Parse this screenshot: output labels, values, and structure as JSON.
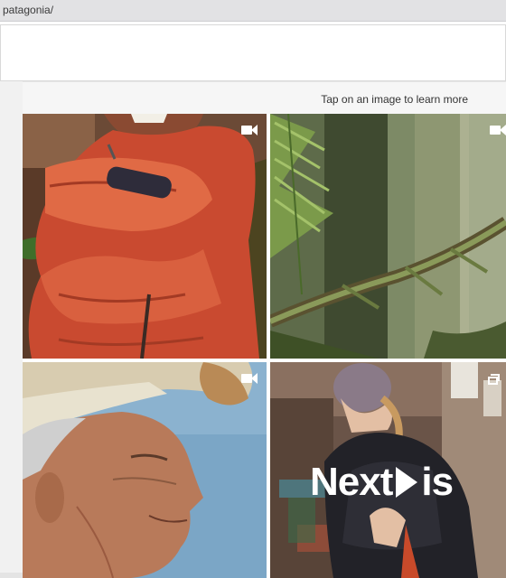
{
  "browser": {
    "address_text": "patagonia/"
  },
  "gallery": {
    "hint": "Tap on an image to learn more",
    "tiles": [
      {
        "subject": "man in red puffer jacket",
        "media_icon": "video-camera-icon"
      },
      {
        "subject": "forest ferns and mossy branch",
        "media_icon": "video-camera-icon"
      },
      {
        "subject": "elder man wearing fur hat",
        "media_icon": "video-camera-icon"
      },
      {
        "subject": "woman in black puffer jacket",
        "media_icon": "gallery-icon",
        "overlay_word1": "Next",
        "overlay_word2": "is"
      }
    ]
  },
  "colors": {
    "accent_red": "#c94a30",
    "forest_green": "#5e7a3e",
    "sky_blue": "#7ba6c6"
  }
}
